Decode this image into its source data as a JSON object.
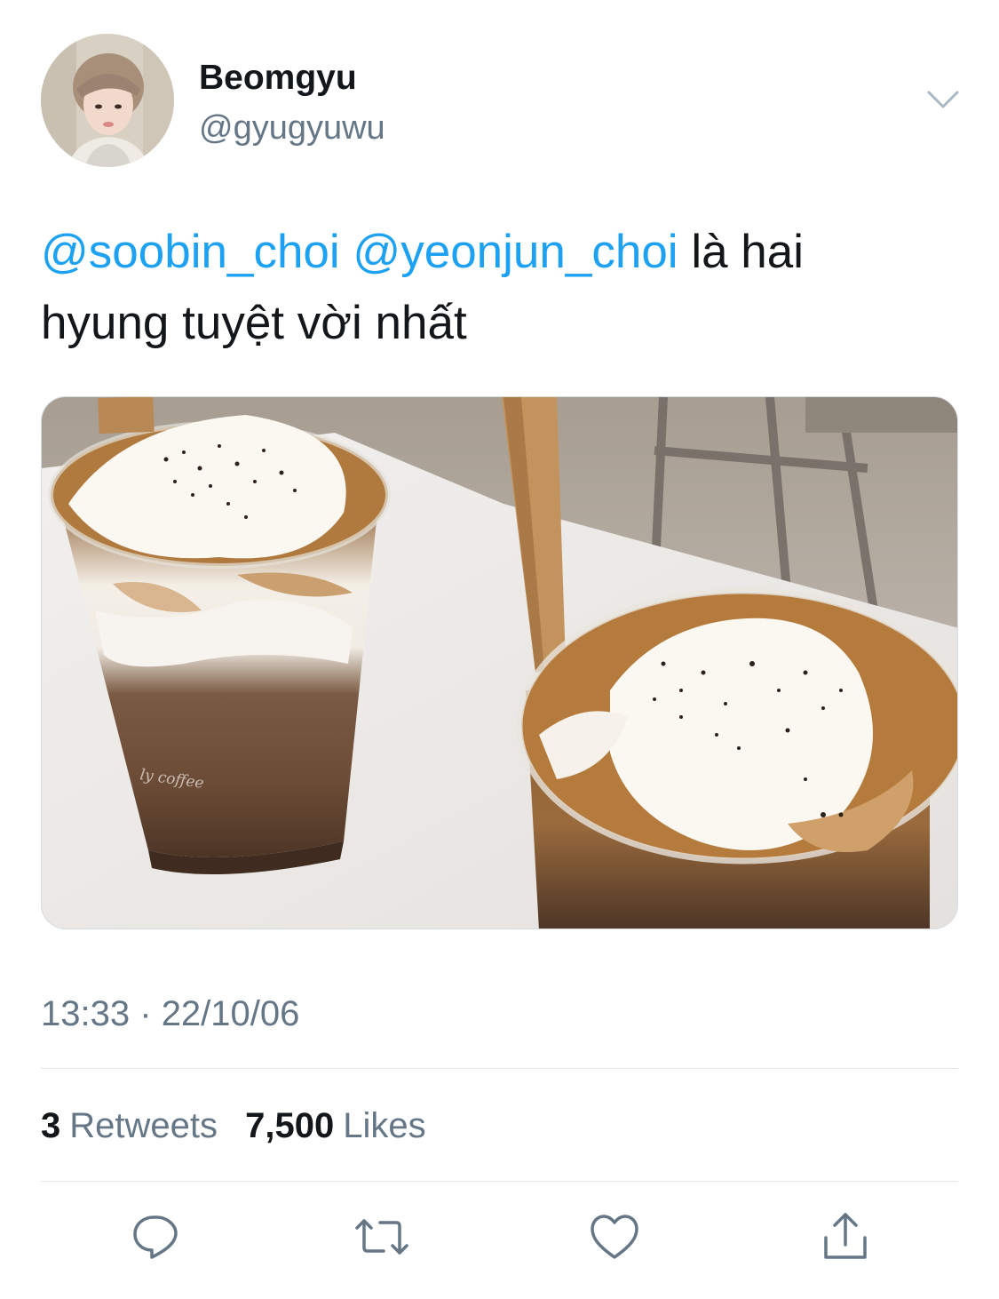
{
  "author": {
    "display_name": "Beomgyu",
    "handle": "@gyugyuwu"
  },
  "tweet": {
    "mention_1": "@soobin_choi",
    "mention_2": "@yeonjun_choi",
    "text_after_mentions": "là hai",
    "text_line_2": "hyung tuyệt vời nhất"
  },
  "media": {
    "type": "photo",
    "cup_print": "ly coffee"
  },
  "meta": {
    "time": "13:33",
    "separator": "·",
    "date": "22/10/06"
  },
  "stats": {
    "retweets_count": "3",
    "retweets_label": "Retweets",
    "likes_count": "7,500",
    "likes_label": "Likes"
  },
  "actions": [
    "reply-icon",
    "retweet-icon",
    "like-icon",
    "share-icon"
  ],
  "colors": {
    "mention": "#1da1f2",
    "secondary_text": "#657786",
    "primary_text": "#14171a",
    "icon": "#657786",
    "divider": "#e1e8ed"
  }
}
